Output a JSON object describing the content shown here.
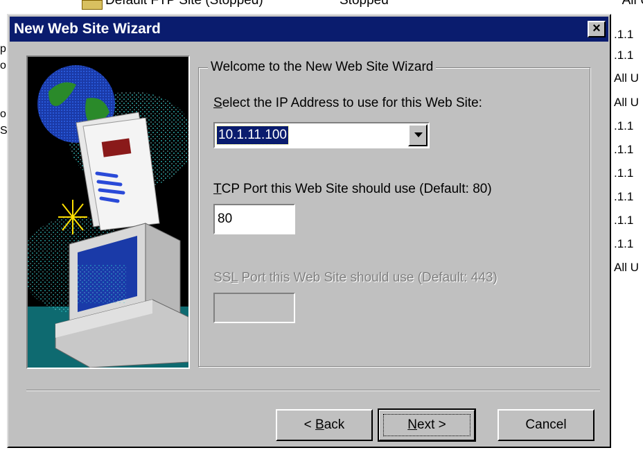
{
  "background": {
    "top_item_name": "Default FTP Site (Stopped)",
    "top_item_state": "Stopped",
    "top_item_ip": "* All U",
    "left_fragments": [
      "p",
      "o",
      "",
      "o",
      "Si"
    ],
    "right_fragments": [
      ".1.1",
      ".1.1",
      "All U",
      "All U",
      ".1.1",
      ".1.1",
      ".1.1",
      ".1.1",
      ".1.1",
      ".1.1",
      "All U"
    ]
  },
  "dialog": {
    "title": "New Web Site Wizard",
    "close_glyph": "×"
  },
  "group": {
    "legend": "Welcome to the New Web Site Wizard"
  },
  "ip": {
    "label_accel": "S",
    "label_rest": "elect the IP Address to use for this Web Site:",
    "selected": "10.1.11.100"
  },
  "tcp": {
    "label_accel": "T",
    "label_rest": "CP Port this Web Site should use (Default: 80)",
    "value": "80"
  },
  "ssl": {
    "label_pre": "SS",
    "label_accel": "L",
    "label_rest": " Port this Web Site should use (Default: 443)",
    "value": ""
  },
  "buttons": {
    "back_pre": "< ",
    "back_accel": "B",
    "back_rest": "ack",
    "next_accel": "N",
    "next_rest": "ext >",
    "cancel": "Cancel"
  },
  "colors": {
    "titlebar": "#0a1c6e",
    "face": "#c0c0c0",
    "art_background": "#000000",
    "globe_ocean": "#1a3aa8",
    "globe_land": "#2a8a2a",
    "sparkle": "#2fd0d0"
  },
  "icons": {
    "illustration": "globe-document-computer-icon",
    "dropdown": "chevron-down-icon",
    "close": "close-icon"
  }
}
